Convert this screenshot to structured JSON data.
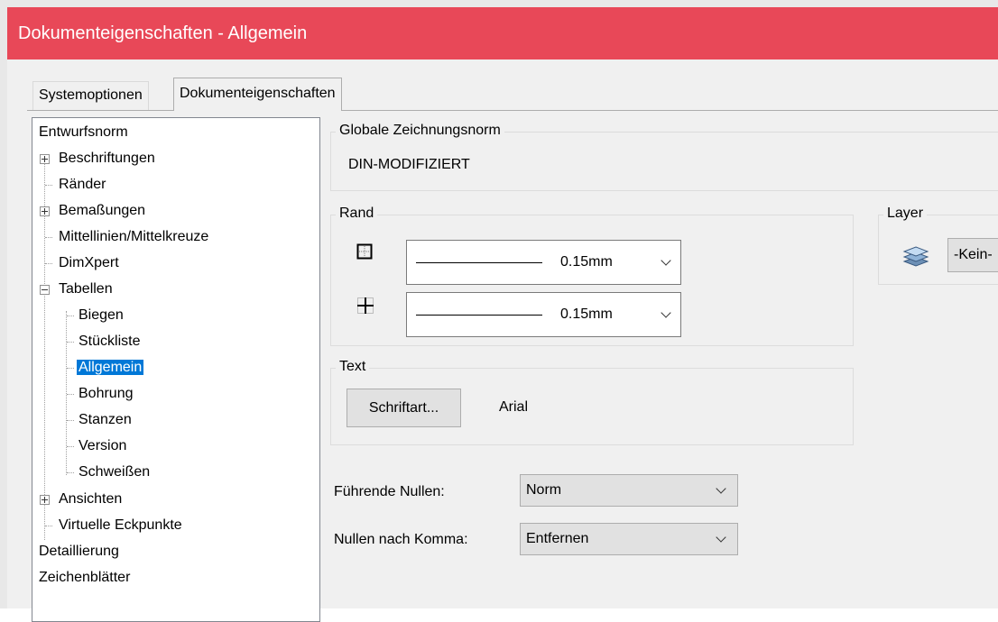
{
  "window": {
    "title": "Dokumenteigenschaften - Allgemein"
  },
  "tabs": [
    {
      "label": "Systemoptionen",
      "active": false
    },
    {
      "label": "Dokumenteigenschaften",
      "active": true
    }
  ],
  "tree": {
    "items": [
      {
        "label": "Entwurfsnorm"
      },
      {
        "label": "Beschriftungen",
        "expander": "plus"
      },
      {
        "label": "Ränder"
      },
      {
        "label": "Bemaßungen",
        "expander": "plus"
      },
      {
        "label": "Mittellinien/Mittelkreuze"
      },
      {
        "label": "DimXpert"
      },
      {
        "label": "Tabellen",
        "expander": "minus"
      },
      {
        "label": "Biegen"
      },
      {
        "label": "Stückliste"
      },
      {
        "label": "Allgemein",
        "selected": true
      },
      {
        "label": "Bohrung"
      },
      {
        "label": "Stanzen"
      },
      {
        "label": "Version"
      },
      {
        "label": "Schweißen"
      },
      {
        "label": "Ansichten",
        "expander": "plus"
      },
      {
        "label": "Virtuelle Eckpunkte"
      },
      {
        "label": "Detaillierung"
      },
      {
        "label": "Zeichenblätter"
      }
    ]
  },
  "global_norm": {
    "legend": "Globale Zeichnungsnorm",
    "value": "DIN-MODIFIZIERT"
  },
  "rand": {
    "legend": "Rand",
    "outer_border": {
      "icon": "border-outside-icon",
      "value": "0.15mm"
    },
    "inner_border": {
      "icon": "border-inside-icon",
      "value": "0.15mm"
    }
  },
  "layer": {
    "legend": "Layer",
    "icon": "layers-icon",
    "value": "-Kein-"
  },
  "text": {
    "legend": "Text",
    "font_button": "Schriftart...",
    "font_name": "Arial"
  },
  "leading_zeros": {
    "label": "Führende Nullen:",
    "value": "Norm"
  },
  "trailing_zeros": {
    "label": "Nullen nach Komma:",
    "value": "Entfernen"
  },
  "colors": {
    "titlebar": "#e84858",
    "selection": "#0078d7"
  }
}
